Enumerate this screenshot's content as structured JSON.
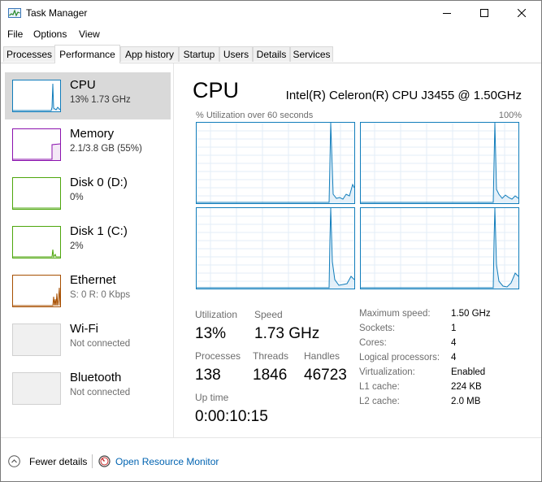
{
  "window": {
    "title": "Task Manager"
  },
  "menu": {
    "items": [
      "File",
      "Options",
      "View"
    ]
  },
  "tabs": [
    "Processes",
    "Performance",
    "App history",
    "Startup",
    "Users",
    "Details",
    "Services"
  ],
  "sidebar": {
    "items": [
      {
        "name": "CPU",
        "sub": "13% 1.73 GHz"
      },
      {
        "name": "Memory",
        "sub": "2.1/3.8 GB (55%)"
      },
      {
        "name": "Disk 0 (D:)",
        "sub": "0%"
      },
      {
        "name": "Disk 1 (C:)",
        "sub": "2%"
      },
      {
        "name": "Ethernet",
        "sub": "S: 0 R: 0 Kbps"
      },
      {
        "name": "Wi-Fi",
        "sub": "Not connected"
      },
      {
        "name": "Bluetooth",
        "sub": "Not connected"
      }
    ]
  },
  "main": {
    "title": "CPU",
    "model": "Intel(R) Celeron(R) CPU J3455 @ 1.50GHz",
    "util_label": "% Utilization over 60 seconds",
    "util_max": "100%",
    "stats": {
      "utilization": {
        "label": "Utilization",
        "value": "13%"
      },
      "speed": {
        "label": "Speed",
        "value": "1.73 GHz"
      },
      "processes": {
        "label": "Processes",
        "value": "138"
      },
      "threads": {
        "label": "Threads",
        "value": "1846"
      },
      "handles": {
        "label": "Handles",
        "value": "46723"
      },
      "uptime": {
        "label": "Up time",
        "value": "0:00:10:15"
      }
    },
    "specs": [
      {
        "label": "Maximum speed:",
        "value": "1.50 GHz"
      },
      {
        "label": "Sockets:",
        "value": "1"
      },
      {
        "label": "Cores:",
        "value": "4"
      },
      {
        "label": "Logical processors:",
        "value": "4"
      },
      {
        "label": "Virtualization:",
        "value": "Enabled"
      },
      {
        "label": "L1 cache:",
        "value": "224 KB"
      },
      {
        "label": "L2 cache:",
        "value": "2.0 MB"
      }
    ]
  },
  "footer": {
    "fewer_details": "Fewer details",
    "open_resource_monitor": "Open Resource Monitor"
  },
  "colors": {
    "cpu": "#117dbb",
    "memory": "#8b12ae",
    "disk": "#4da60c",
    "ethernet": "#a74f01",
    "link": "#0063b1"
  },
  "icons": {
    "app": "task-manager-icon",
    "minimize": "minimize-icon",
    "maximize": "maximize-icon",
    "close": "close-icon",
    "fewer": "chevron-up-circle-icon",
    "resource_monitor": "resource-monitor-icon"
  }
}
